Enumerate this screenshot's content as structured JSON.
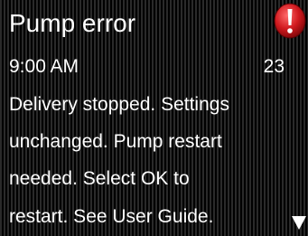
{
  "screen": {
    "title": "Pump error",
    "time": "9:00 AM",
    "count": "23",
    "message_lines": [
      "Delivery stopped. Settings",
      "unchanged. Pump restart",
      "needed. Select OK to",
      "restart. See User Guide."
    ]
  },
  "icons": {
    "alert": "alert-exclamation-icon",
    "scroll": "scroll-down-arrow-icon"
  },
  "colors": {
    "background": "#000000",
    "text": "#ffffff",
    "alert": "#c8141a"
  }
}
